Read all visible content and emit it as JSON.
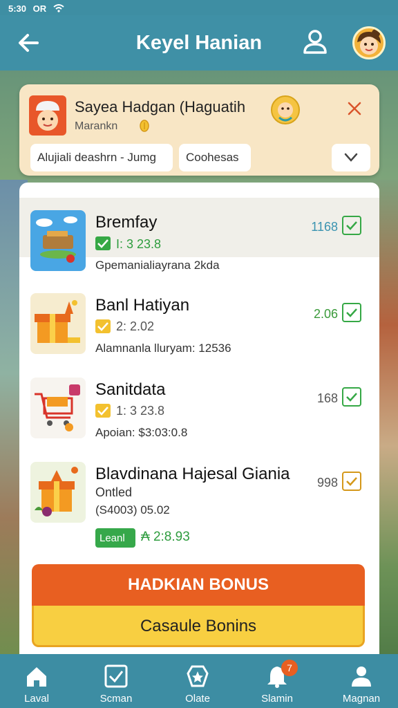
{
  "status": {
    "time": "5:30",
    "network": "OR"
  },
  "header": {
    "title": "Keyel Hanian"
  },
  "notification": {
    "title": "Sayea Hadgan (Haguatih",
    "subtitle": "Marankn",
    "chip1": "Alujiali deashrn - Jumg",
    "chip2": "Coohesas"
  },
  "items": [
    {
      "name": "Bremfay",
      "value": "I: 3 23.8",
      "desc": "Gpemanialiayrana 2kda",
      "count": "1168",
      "count_color": "#3a93b0",
      "highlighted": true,
      "check_color": "#35a845"
    },
    {
      "name": "Banl Hatiyan",
      "value": "2: 2.02",
      "desc": "Alamnanla lluryam: 12536",
      "count": "2.06",
      "count_color": "#3a9a3a",
      "highlighted": false,
      "check_color": "#f3c12f"
    },
    {
      "name": "Sanitdata",
      "value": "1: 3 23.8",
      "desc": "Apoian: $3:03:0.8",
      "count": "168",
      "count_color": "#555555",
      "highlighted": false,
      "check_color": "#f3c12f"
    },
    {
      "name": "Blavdinana Hajesal Giania",
      "value": "Ontled",
      "desc": "(S4003) 05.02",
      "count": "998",
      "count_color": "#555555",
      "highlighted": false,
      "check_color": "#f3c12f"
    }
  ],
  "tag": {
    "label": "Leanl",
    "value": "₳ 2:8.93"
  },
  "buttons": {
    "primary": "HADKIAN BONUS",
    "secondary": "Casaule Bonins"
  },
  "nav": [
    {
      "label": "Laval",
      "icon": "home-icon"
    },
    {
      "label": "Scman",
      "icon": "checkbox-icon"
    },
    {
      "label": "Olate",
      "icon": "star-badge-icon"
    },
    {
      "label": "Slamin",
      "icon": "bell-icon",
      "badge": "7"
    },
    {
      "label": "Magnan",
      "icon": "user-icon"
    }
  ],
  "colors": {
    "header": "#3f90a6",
    "primary_button": "#e85f21",
    "secondary_button": "#f8cf41",
    "accent_green": "#35a845"
  }
}
